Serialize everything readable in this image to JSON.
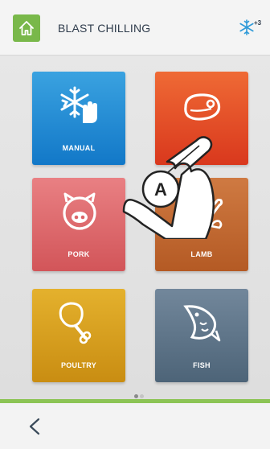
{
  "header": {
    "title": "BLAST CHILLING",
    "badge": "+3"
  },
  "tiles": [
    {
      "label": "MANUAL",
      "color": "#1d86d2"
    },
    {
      "label": "",
      "color": "#e4482a"
    },
    {
      "label": "PORK",
      "color": "#dd6669"
    },
    {
      "label": "LAMB",
      "color": "#c06830"
    },
    {
      "label": "POULTRY",
      "color": "#d69d1e"
    },
    {
      "label": "FISH",
      "color": "#5e7489"
    }
  ],
  "pager": {
    "pages": 2,
    "current": 1
  },
  "overlay": {
    "marker": "A"
  },
  "colors": {
    "accent_green": "#8cc455",
    "home_button": "#79b84a",
    "title_text": "#2f3c4c"
  },
  "icons": {
    "home": "home-icon",
    "snowflake": "snowflake-icon",
    "back": "chevron-left-icon"
  }
}
